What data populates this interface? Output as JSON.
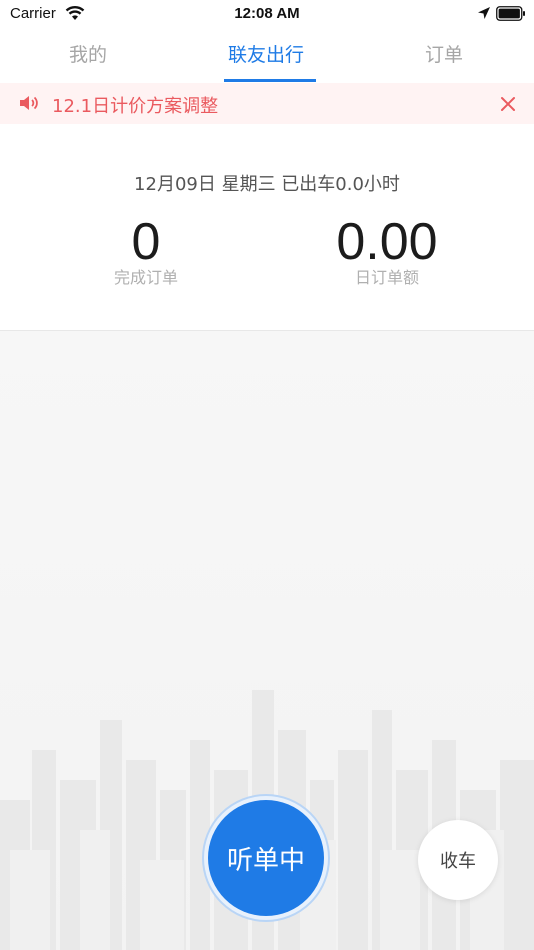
{
  "status_bar": {
    "carrier": "Carrier",
    "time": "12:08 AM",
    "icons": [
      "wifi-icon",
      "location-arrow-icon",
      "battery-icon"
    ]
  },
  "tabs": [
    {
      "label": "我的",
      "active": false
    },
    {
      "label": "联友出行",
      "active": true
    },
    {
      "label": "订单",
      "active": false
    }
  ],
  "notice": {
    "icon": "speaker-icon",
    "text": "12.1日计价方案调整",
    "close_icon": "close-icon"
  },
  "stats": {
    "date_line": "12月09日 星期三 已出车0.0小时",
    "orders": {
      "value": "0",
      "label": "完成订单"
    },
    "amount": {
      "value": "0.00",
      "label": "日订单额"
    }
  },
  "actions": {
    "listen_label": "听单中",
    "offduty_label": "收车"
  },
  "colors": {
    "accent": "#1f7be6",
    "notice_text": "#ea5a5f",
    "notice_bg": "#fff3f3",
    "inactive_tab": "#a6a6a6"
  }
}
